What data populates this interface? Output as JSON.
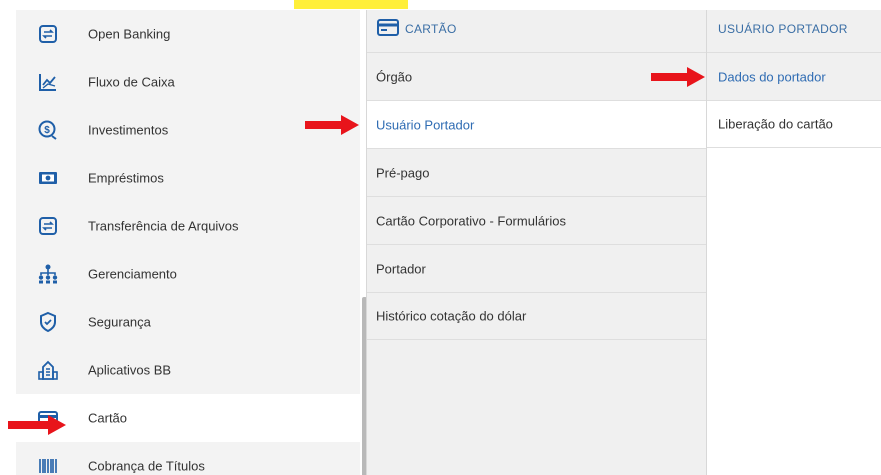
{
  "main_menu": {
    "items": [
      {
        "label": "Open Banking",
        "icon": "open-banking-icon"
      },
      {
        "label": "Fluxo de Caixa",
        "icon": "cash-flow-chart-icon"
      },
      {
        "label": "Investimentos",
        "icon": "investments-coin-icon"
      },
      {
        "label": "Empréstimos",
        "icon": "loans-banknote-icon"
      },
      {
        "label": "Transferência de Arquivos",
        "icon": "file-transfer-icon"
      },
      {
        "label": "Gerenciamento",
        "icon": "management-hierarchy-icon"
      },
      {
        "label": "Segurança",
        "icon": "security-shield-icon"
      },
      {
        "label": "Aplicativos BB",
        "icon": "apps-building-icon"
      },
      {
        "label": "Cartão",
        "icon": "card-icon"
      },
      {
        "label": "Cobrança de Títulos",
        "icon": "billing-barcode-icon"
      }
    ],
    "selected": "Cartão"
  },
  "card_submenu": {
    "header": "CARTÃO",
    "header_icon": "card-icon",
    "items": [
      {
        "label": "Órgão"
      },
      {
        "label": "Usuário Portador"
      },
      {
        "label": "Pré-pago"
      },
      {
        "label": "Cartão Corporativo - Formulários"
      },
      {
        "label": "Portador"
      },
      {
        "label": "Histórico cotação do dólar"
      }
    ],
    "selected": "Usuário Portador"
  },
  "holder_submenu": {
    "header": "USUÁRIO PORTADOR",
    "items": [
      {
        "label": "Dados do portador"
      },
      {
        "label": "Liberação do cartão"
      }
    ],
    "selected": "Dados do portador"
  },
  "colors": {
    "arrow": "#e8141b",
    "accent_blue": "#2f6cb3",
    "icon_blue": "#1f5fa8",
    "highlight": "#ffef3a"
  }
}
